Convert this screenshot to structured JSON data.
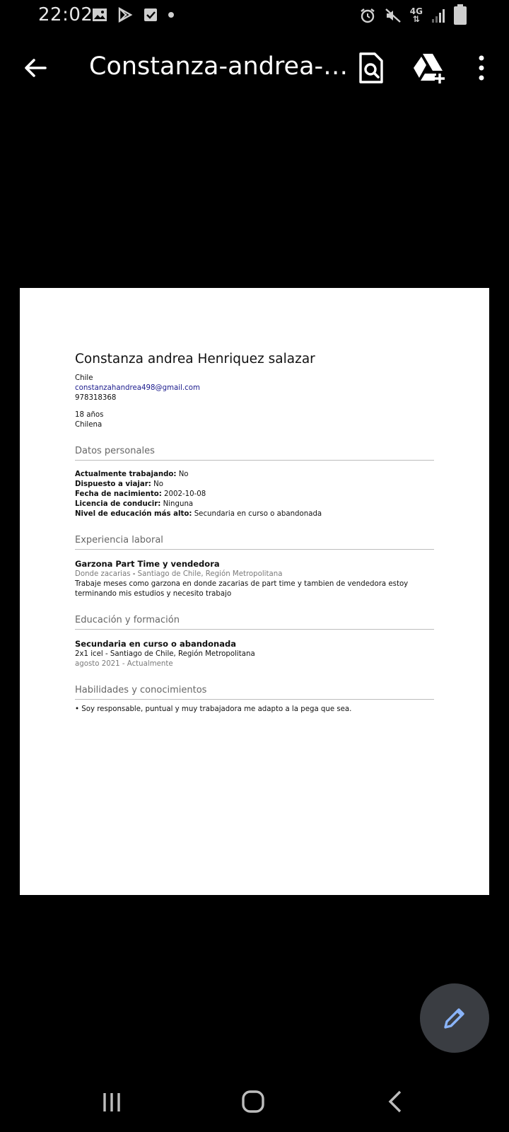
{
  "status_bar": {
    "time": "22:02",
    "network": "4G",
    "left_icons": [
      "image-icon",
      "play-store-icon",
      "checkbox-icon",
      "dot-icon"
    ],
    "right_icons": [
      "alarm-icon",
      "mute-icon",
      "network-4g-icon",
      "signal-icon",
      "battery-icon"
    ]
  },
  "app_bar": {
    "title": "Constanza-andrea-…",
    "buttons": [
      "back-arrow-icon",
      "find-in-document-icon",
      "add-to-drive-icon",
      "more-vertical-icon"
    ]
  },
  "document": {
    "name": "Constanza andrea Henriquez salazar",
    "country": "Chile",
    "email": "constanzahandrea498@gmail.com",
    "phone": "978318368",
    "age": "18 años",
    "nationality": "Chilena",
    "personal": {
      "title": "Datos personales",
      "rows": [
        {
          "label": "Actualmente trabajando:",
          "value": "No"
        },
        {
          "label": "Dispuesto a viajar:",
          "value": "No"
        },
        {
          "label": "Fecha de nacimiento:",
          "value": "2002-10-08"
        },
        {
          "label": "Licencia de conducir:",
          "value": "Ninguna"
        },
        {
          "label": "Nivel de educación más alto:",
          "value": "Secundaria en curso o abandonada"
        }
      ]
    },
    "experience": {
      "title": "Experiencia laboral",
      "job_title": "Garzona Part Time y vendedora",
      "company": "Donde zacarias",
      "location_sep": " - ",
      "location": "Santiago de Chile, Región Metropolitana",
      "description": "Trabaje meses como garzona en donde zacarias de part time y tambien de vendedora estoy terminando mis estudios y necesito trabajo"
    },
    "education": {
      "title": "Educación y formación",
      "degree": "Secundaria en curso o abandonada",
      "school": "2x1 icel - Santiago de Chile, Región Metropolitana",
      "dates": "agosto 2021 - Actualmente"
    },
    "skills": {
      "title": "Habilidades y conocimientos",
      "items": [
        "• Soy responsable, puntual y muy trabajadora me adapto a la pega que sea."
      ]
    }
  },
  "fab": {
    "icon": "edit-pencil-icon",
    "color": "#8ab4f8"
  },
  "nav_bar": {
    "buttons": [
      "recent-apps-icon",
      "home-icon",
      "back-icon"
    ]
  },
  "colors": {
    "background": "#000000",
    "page": "#ffffff",
    "fab_bg": "#3a3d42",
    "link": "#1a1a8c"
  }
}
